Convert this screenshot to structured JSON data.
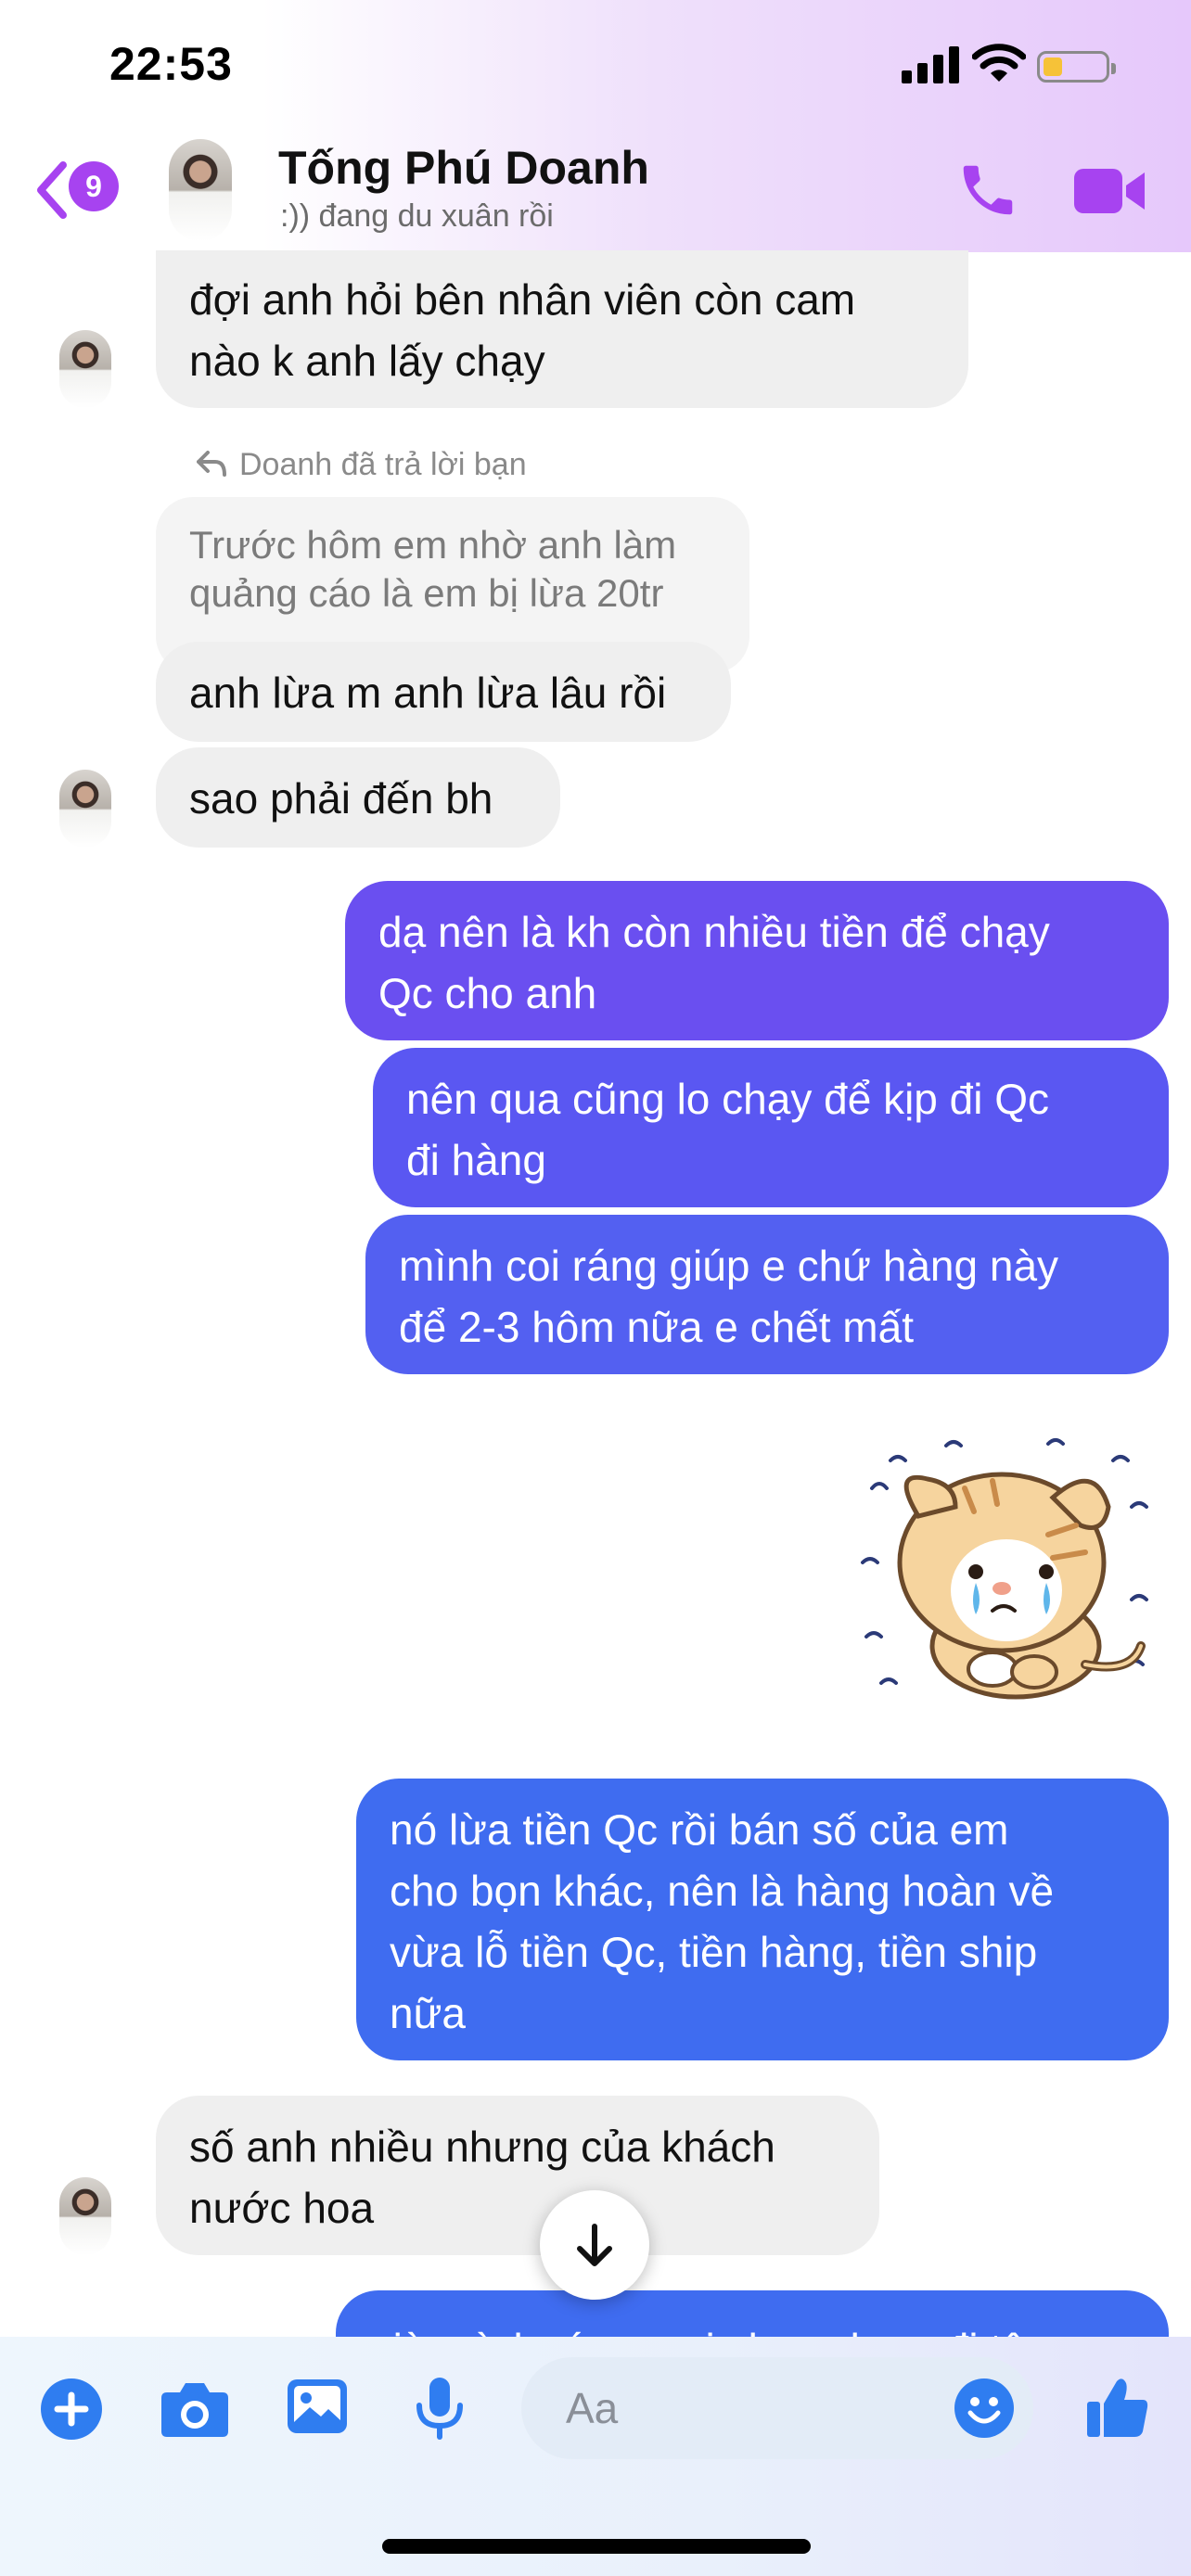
{
  "status_bar": {
    "time": "22:53"
  },
  "header": {
    "back_badge": "9",
    "contact_name": "Tống Phú Doanh",
    "contact_status": ":)) đang du xuân rồi"
  },
  "messages": [
    {
      "side": "in",
      "text": "đợi anh hỏi bên nhân viên còn cam\nnào k anh lấy chạy"
    },
    {
      "side": "in",
      "reply_label": "Doanh đã trả lời bạn",
      "quoted": "Trước hôm em nhờ anh làm\nquảng cáo là em bị lừa 20tr",
      "text": "anh lừa m anh lừa lâu rồi"
    },
    {
      "side": "in",
      "text": "sao phải đến bh"
    },
    {
      "side": "out",
      "text": "dạ nên là kh còn nhiều tiền để chạy\nQc cho anh"
    },
    {
      "side": "out",
      "text": "nên qua cũng lo chạy để kịp đi Qc\nđi hàng"
    },
    {
      "side": "out",
      "text": "mình coi ráng giúp e chứ hàng này\nđể 2-3 hôm nữa e chết mất"
    },
    {
      "side": "out",
      "sticker": "crying-cat-sticker"
    },
    {
      "side": "out",
      "text": "nó lừa tiền Qc rồi bán số của em\ncho bọn khác, nên là hàng hoàn về\nvừa lỗ tiền Qc, tiền hàng, tiền ship\nnữa"
    },
    {
      "side": "in",
      "text": "số anh nhiều nhưng của khách\nnước hoa"
    },
    {
      "side": "out",
      "text": "giờ mình ráng mai chay cho e đi tâm"
    }
  ],
  "composer": {
    "placeholder": "Aa"
  },
  "colors": {
    "accent": "#a743f0",
    "bubble_in": "#efefef",
    "out_gradient": [
      "#6a4ff0",
      "#5a57f2",
      "#4a64f0",
      "#3f6cf0"
    ]
  }
}
